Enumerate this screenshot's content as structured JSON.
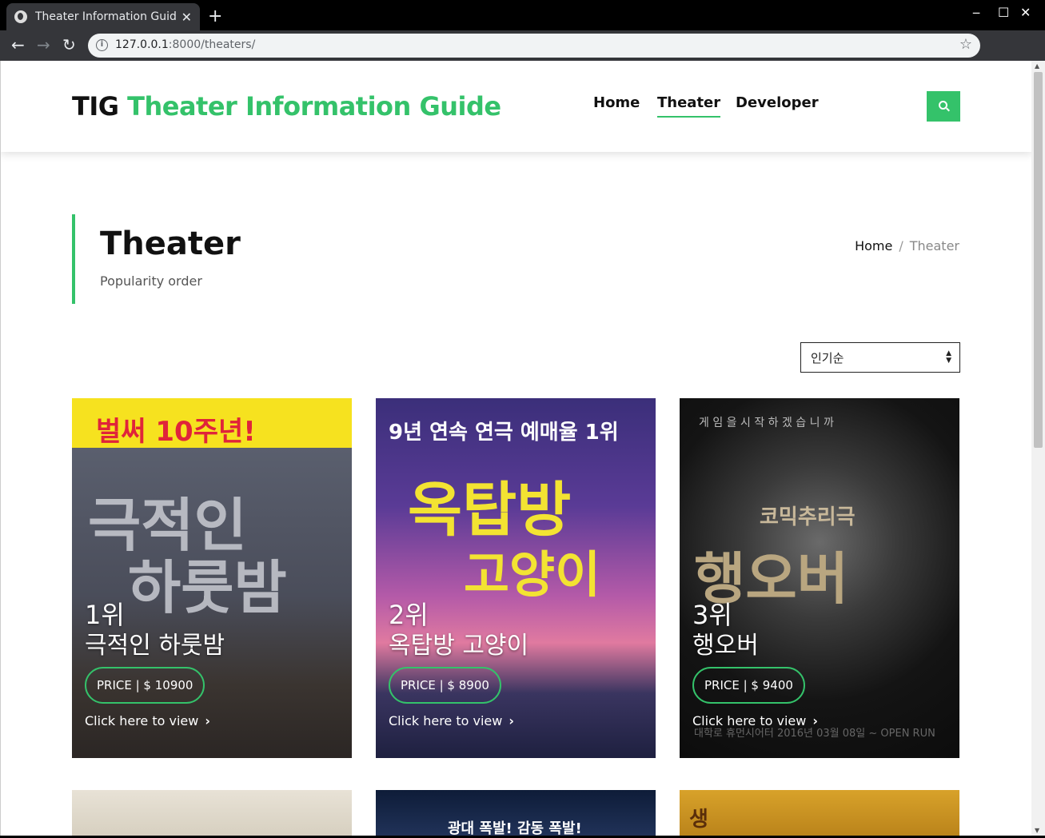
{
  "browser": {
    "tab_title": "Theater Information Guid",
    "url_host": "127.0.0.1",
    "url_rest": ":8000/theaters/"
  },
  "header": {
    "brand": "TIG",
    "site_name": "Theater Information Guide",
    "nav": [
      "Home",
      "Theater",
      "Developer"
    ],
    "active_nav": "Theater",
    "accent_color": "#34c26a"
  },
  "page": {
    "title": "Theater",
    "subtitle": "Popularity order",
    "breadcrumb": {
      "home": "Home",
      "separator": "/",
      "current": "Theater"
    }
  },
  "sort": {
    "selected": "인기순"
  },
  "cards": [
    {
      "rank": "1위",
      "title": "극적인 하룻밤",
      "price": "PRICE | $ 10900",
      "link": "Click here to view",
      "poster_text": [
        "벌써 10주년!",
        "극적인",
        "하룻밤"
      ]
    },
    {
      "rank": "2위",
      "title": "옥탑방 고양이",
      "price": "PRICE | $ 8900",
      "link": "Click here to view",
      "poster_text": [
        "9년 연속 연극 예매율 1위",
        "옥탑방",
        "고양이"
      ]
    },
    {
      "rank": "3위",
      "title": "행오버",
      "price": "PRICE | $ 9400",
      "link": "Click here to view",
      "poster_text": [
        "게 임 을   시 작 하 겠 습 니 까",
        "코믹추리극",
        "행오버",
        "대학로 휴먼시어터 2016년 03월 08일 ~ OPEN RUN"
      ]
    }
  ],
  "partial_cards": [
    {
      "poster_text": ""
    },
    {
      "poster_text": "광대 폭발! 감동 폭발!"
    },
    {
      "poster_text": "생"
    }
  ]
}
